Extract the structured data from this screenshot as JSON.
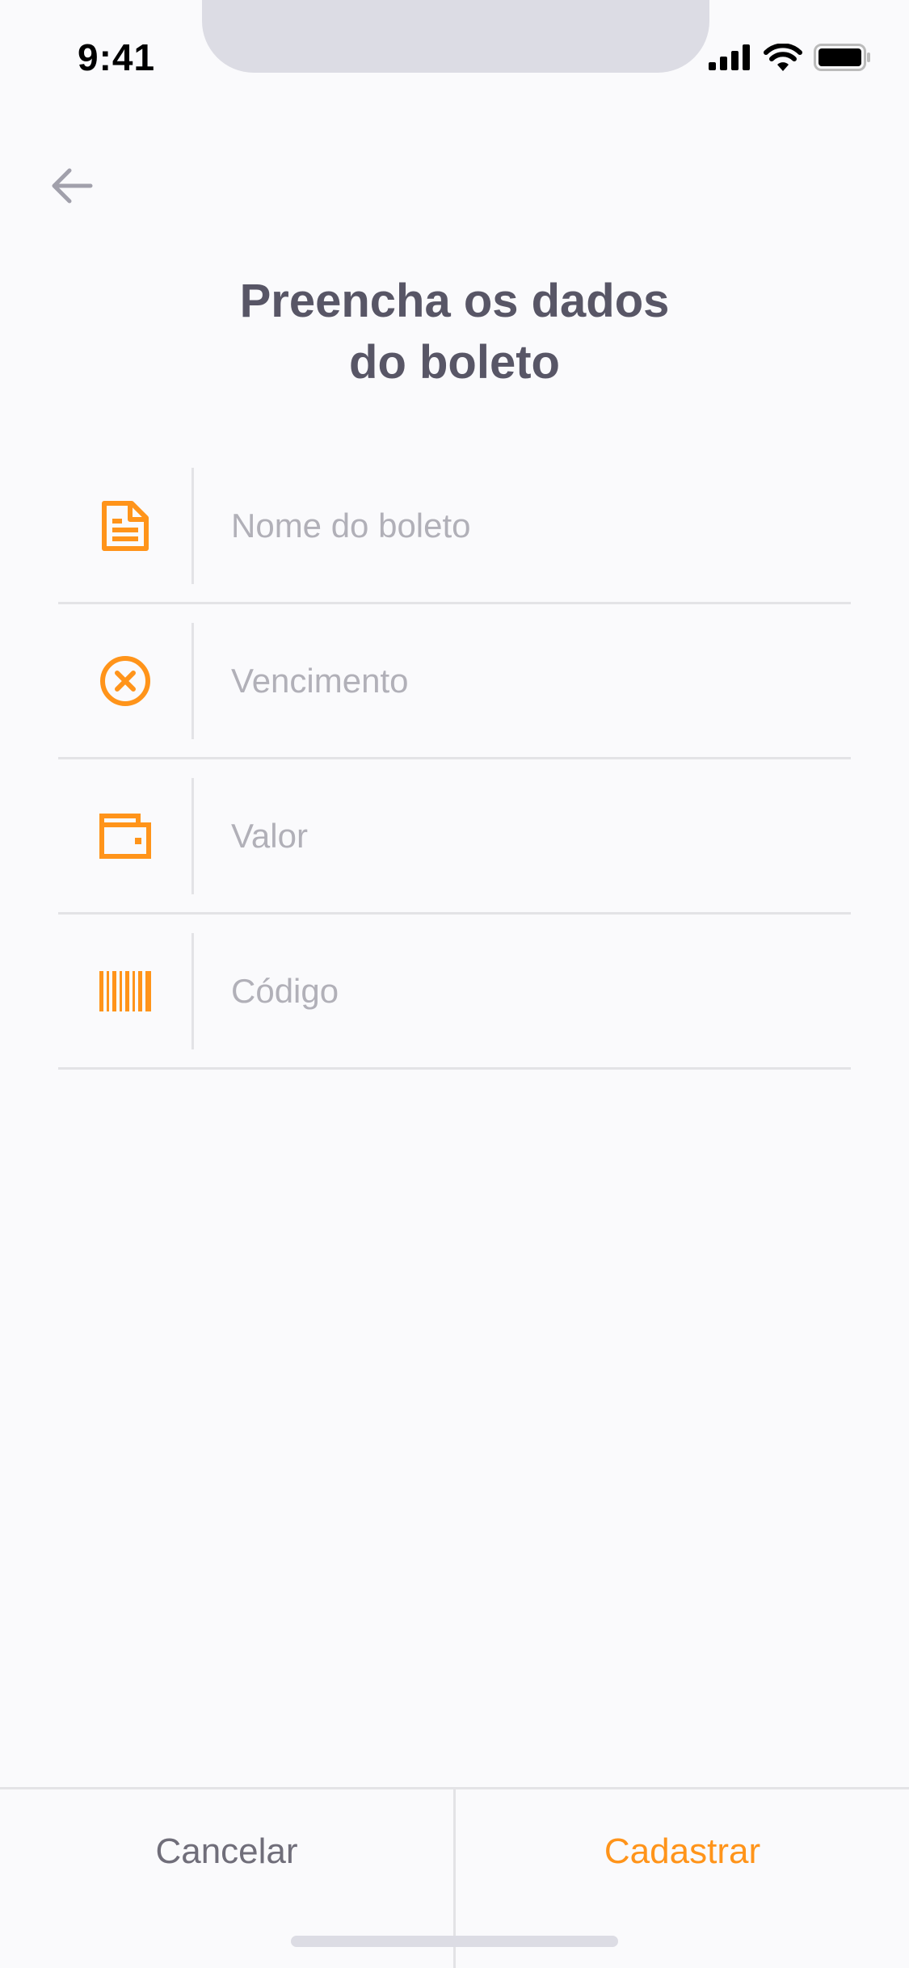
{
  "status_bar": {
    "time": "9:41",
    "icons": [
      "signal-icon",
      "wifi-icon",
      "battery-icon"
    ]
  },
  "header": {
    "back_icon": "arrow-left-icon",
    "title_line1": "Preencha os dados",
    "title_line2": "do boleto"
  },
  "form": {
    "fields": [
      {
        "icon": "document-icon",
        "placeholder": "Nome do boleto",
        "value": ""
      },
      {
        "icon": "close-circle-icon",
        "placeholder": "Vencimento",
        "value": ""
      },
      {
        "icon": "wallet-icon",
        "placeholder": "Valor",
        "value": ""
      },
      {
        "icon": "barcode-icon",
        "placeholder": "Código",
        "value": ""
      }
    ]
  },
  "actions": {
    "cancel_label": "Cancelar",
    "register_label": "Cadastrar"
  },
  "colors": {
    "accent": "#FF941A",
    "heading": "#585666",
    "placeholder": "#B1B0B8",
    "divider": "#E3E3E6",
    "background": "#FAFAFC"
  }
}
